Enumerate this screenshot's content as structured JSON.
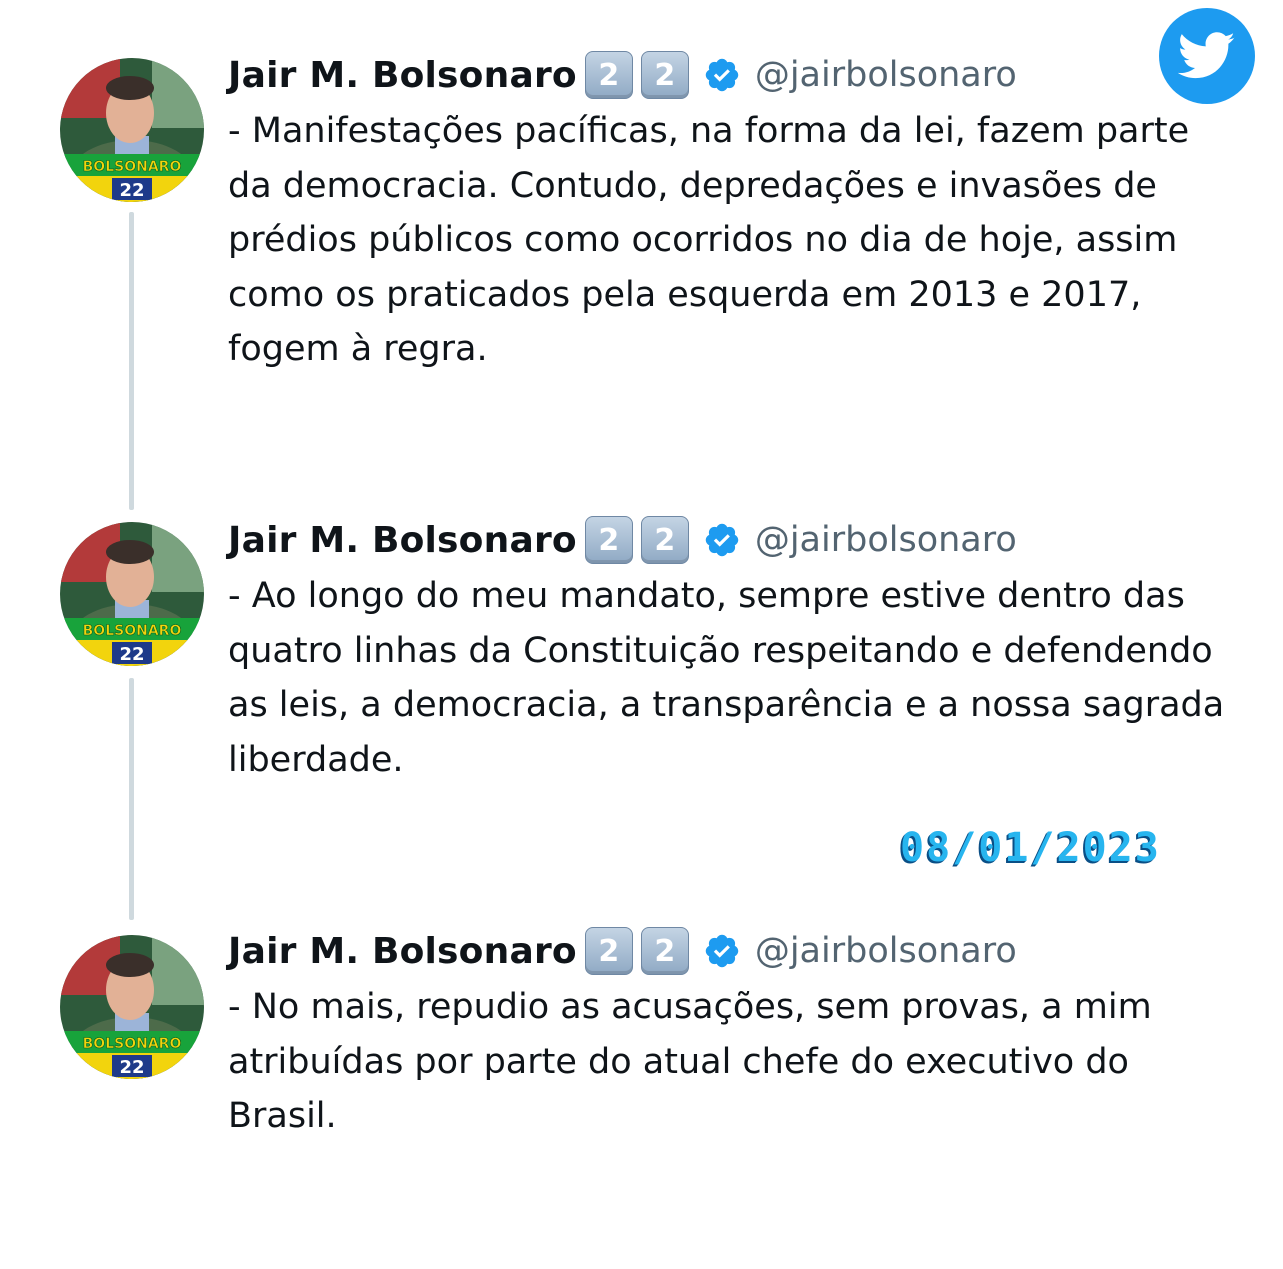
{
  "icons": {
    "corner_logo": "twitter-bird-icon",
    "verified": "verified-badge-icon"
  },
  "colors": {
    "twitter_blue": "#1d9bf0",
    "verified_blue": "#1d9bf0",
    "handle_gray": "#536471",
    "date_blue": "#27b5ef"
  },
  "tweets": [
    {
      "author": {
        "name": "Jair M. Bolsonaro",
        "badge": [
          "2",
          "2"
        ],
        "handle": "@jairbolsonaro",
        "avatar_label": "BOLSONARO",
        "avatar_number": "22"
      },
      "text": "- Manifestações pacíficas, na forma da lei, fazem parte da democracia. Contudo, depredações e invasões de prédios públicos como ocorridos no dia de hoje, assim como os praticados pela esquerda em 2013 e 2017, fogem à regra."
    },
    {
      "author": {
        "name": "Jair M. Bolsonaro",
        "badge": [
          "2",
          "2"
        ],
        "handle": "@jairbolsonaro",
        "avatar_label": "BOLSONARO",
        "avatar_number": "22"
      },
      "text": "- Ao longo do meu mandato, sempre estive dentro das quatro linhas da Constituição respeitando e defendendo as leis, a democracia, a transparência e a nossa sagrada liberdade."
    },
    {
      "author": {
        "name": "Jair M. Bolsonaro",
        "badge": [
          "2",
          "2"
        ],
        "handle": "@jairbolsonaro",
        "avatar_label": "BOLSONARO",
        "avatar_number": "22"
      },
      "text": "- No mais, repudio as acusações, sem provas, a mim atribuídas por parte do atual chefe do executivo do Brasil."
    }
  ],
  "date_stamp": "08/01/2023"
}
